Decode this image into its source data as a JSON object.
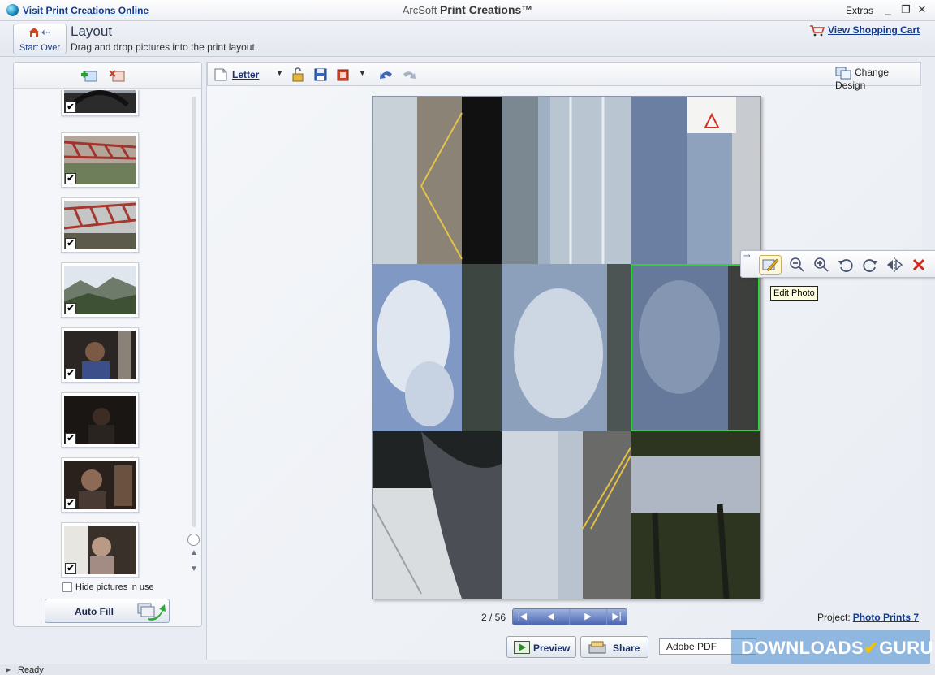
{
  "titlebar": {
    "visit_link": "Visit Print Creations Online",
    "app_prefix": "ArcSoft",
    "app_name": "Print Creations™",
    "extras": "Extras",
    "minimize": "_",
    "restore": "❐",
    "close": "✕"
  },
  "header": {
    "start_over": "Start Over",
    "title": "Layout",
    "subtitle": "Drag and drop pictures into the print layout.",
    "cart_link": "View Shopping Cart"
  },
  "left_panel": {
    "hide_pictures_label": "Hide pictures in use",
    "auto_fill_label": "Auto Fill",
    "thumbnails": [
      {
        "checked": true,
        "check": "✔",
        "style": "car-interior"
      },
      {
        "checked": true,
        "check": "✔",
        "style": "red-bridge"
      },
      {
        "checked": true,
        "check": "✔",
        "style": "red-bridge"
      },
      {
        "checked": true,
        "check": "✔",
        "style": "mountains"
      },
      {
        "checked": true,
        "check": "✔",
        "style": "child-dark"
      },
      {
        "checked": true,
        "check": "✔",
        "style": "dark-room"
      },
      {
        "checked": true,
        "check": "✔",
        "style": "child-dark"
      },
      {
        "checked": true,
        "check": "✔",
        "style": "child-window"
      }
    ]
  },
  "toolbar": {
    "paper_size": "Letter",
    "change_design": "Change Design"
  },
  "photo_toolbar": {
    "tooltip": "Edit Photo"
  },
  "pager": {
    "page_indicator": "2 / 56",
    "first": "|◀",
    "prev": "◀",
    "next": "▶",
    "last": "▶|"
  },
  "project": {
    "label": "Project:",
    "name": "Photo Prints 7"
  },
  "actions": {
    "preview": "Preview",
    "share": "Share",
    "output_format": "Adobe PDF"
  },
  "watermark": {
    "text_left": "DOWNLOADS",
    "text_right": "GURU",
    "check": "✔"
  },
  "status": {
    "text": "Ready"
  },
  "colors": {
    "link": "#123a8c",
    "selection": "#2ed13a",
    "pager": "#4b66b0"
  }
}
